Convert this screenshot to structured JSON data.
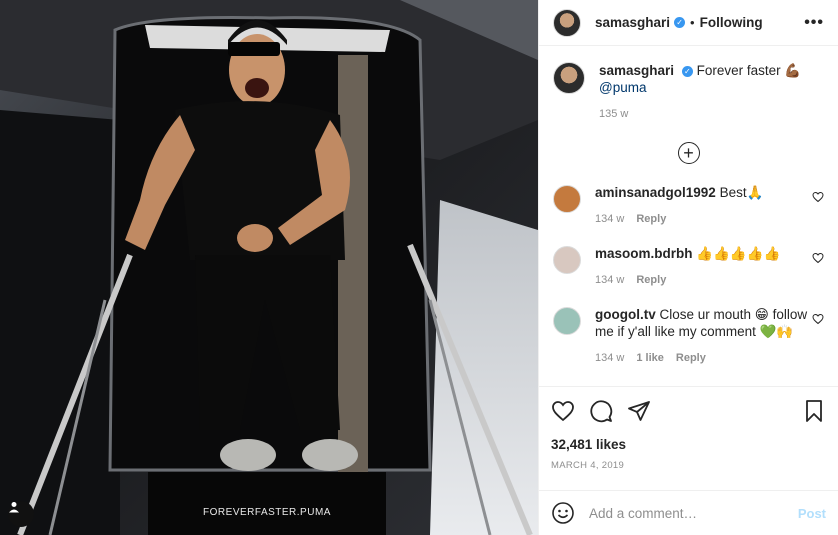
{
  "post": {
    "image_caption_text": "FOREVERFASTER.PUMA",
    "username": "samasghari",
    "follow_state": "Following",
    "more_icon": "more-options-icon"
  },
  "caption": {
    "username": "samasghari",
    "text": "Forever faster 💪🏾",
    "mention": "@puma",
    "time": "135 w"
  },
  "comments": [
    {
      "username": "aminsanadgol1992",
      "text": "Best🙏",
      "time": "134 w",
      "likes": "",
      "reply": "Reply",
      "avatar_color": "#c47a3e"
    },
    {
      "username": "masoom.bdrbh",
      "text": "👍👍👍👍👍",
      "time": "134 w",
      "likes": "",
      "reply": "Reply",
      "avatar_color": "#d8c8c0"
    },
    {
      "username": "googol.tv",
      "text": "Close ur mouth 😁 follow me if y'all like my comment 💚🙌",
      "time": "134 w",
      "likes": "1 like",
      "reply": "Reply",
      "avatar_color": "#9ac2b8"
    }
  ],
  "stats": {
    "likes": "32,481 likes",
    "date": "MARCH 4, 2019"
  },
  "add_comment": {
    "placeholder": "Add a comment…",
    "post_label": "Post"
  },
  "colors": {
    "verified": "#3897f0",
    "post_disabled": "#b2dffc",
    "muted": "#8e8e8e"
  }
}
